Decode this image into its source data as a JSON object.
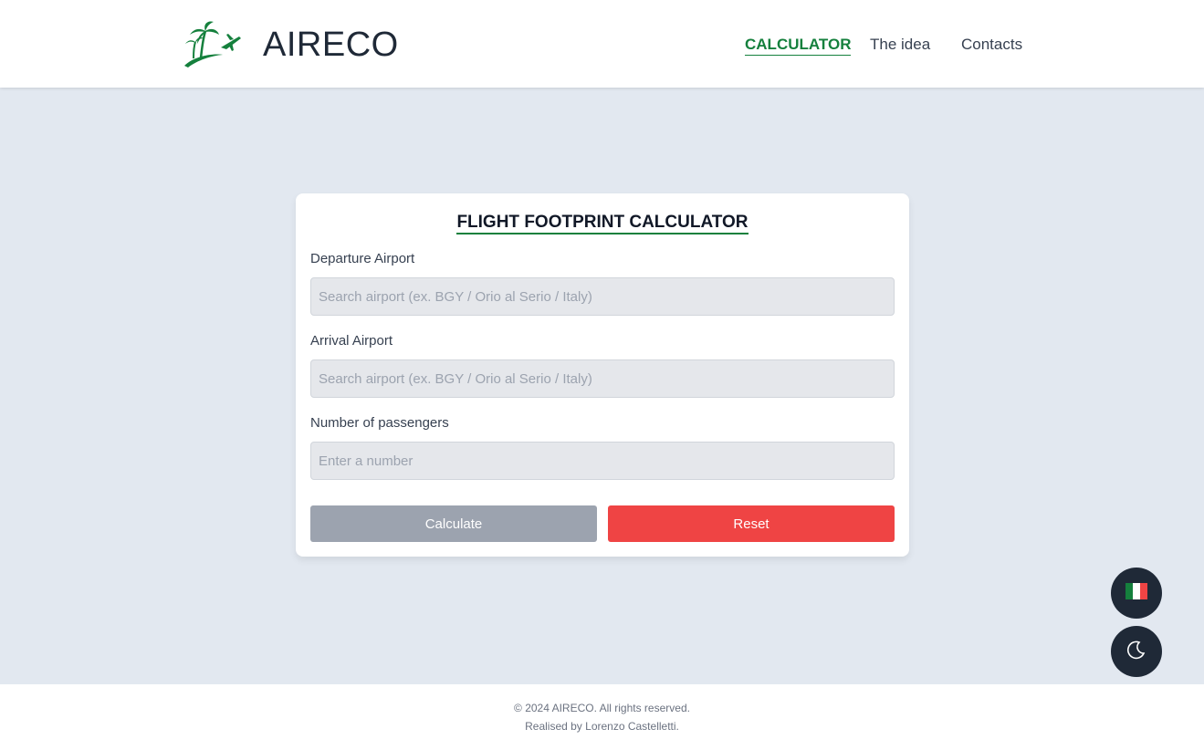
{
  "header": {
    "brand": "AIRECO",
    "nav": {
      "calculator": "CALCULATOR",
      "idea": "The idea",
      "contacts": "Contacts"
    }
  },
  "calculator": {
    "title": "FLIGHT FOOTPRINT CALCULATOR",
    "departure_label": "Departure Airport",
    "departure_placeholder": "Search airport (ex. BGY / Orio al Serio / Italy)",
    "arrival_label": "Arrival Airport",
    "arrival_placeholder": "Search airport (ex. BGY / Orio al Serio / Italy)",
    "passengers_label": "Number of passengers",
    "passengers_placeholder": "Enter a number",
    "calculate_label": "Calculate",
    "reset_label": "Reset"
  },
  "floating": {
    "language_icon": "italy-flag-icon",
    "theme_icon": "moon-icon"
  },
  "footer": {
    "copyright": "© 2024 AIRECO. All rights reserved.",
    "credit": "Realised by Lorenzo Castelletti."
  },
  "colors": {
    "accent": "#15803d",
    "background": "#e2e8f0",
    "reset": "#ef4444",
    "calculate_disabled": "#9ca3af",
    "fab": "#1f2937"
  }
}
